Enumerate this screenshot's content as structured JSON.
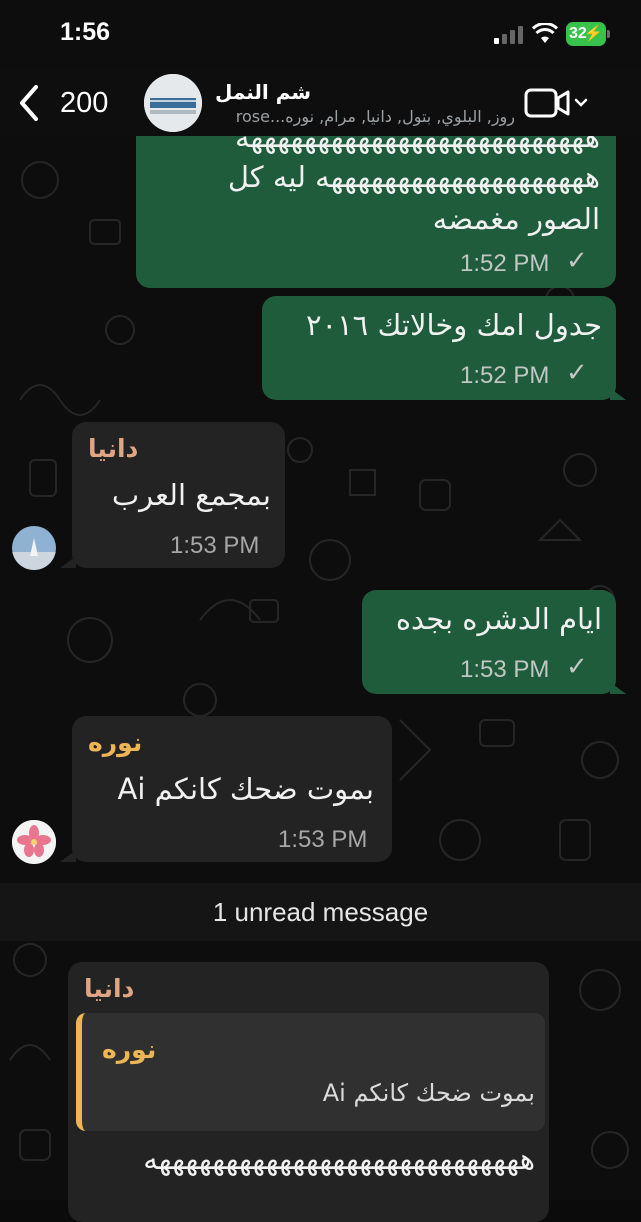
{
  "status_bar": {
    "time": "1:56",
    "battery": "32"
  },
  "header": {
    "back_count": "200",
    "group_name": "شم النمل",
    "members": "روز, البلوي, بتول, دانيا, مرام, نوره...rose"
  },
  "messages": [
    {
      "id": "m1",
      "direction": "out",
      "lines": [
        "ههههههههههههههههههههههههههه",
        "ههههههههههههههههههههه ليه كل",
        "الصور مغمضه"
      ],
      "time": "1:52 PM",
      "status": "sent"
    },
    {
      "id": "m2",
      "direction": "out",
      "lines": [
        "جدول امك وخالاتك ٢٠١٦"
      ],
      "time": "1:52 PM",
      "status": "sent"
    },
    {
      "id": "m3",
      "direction": "in",
      "sender": "دانيا",
      "lines": [
        "بمجمع العرب"
      ],
      "time": "1:53 PM"
    },
    {
      "id": "m4",
      "direction": "out",
      "lines": [
        "ايام الدشره بجده"
      ],
      "time": "1:53 PM",
      "status": "sent"
    },
    {
      "id": "m5",
      "direction": "in",
      "sender": "نوره",
      "lines": [
        "بموت ضحك كانكم Ai"
      ],
      "time": "1:53 PM"
    }
  ],
  "unread_banner": "1 unread message",
  "last_message": {
    "sender": "دانيا",
    "quote_sender": "نوره",
    "quote_text": "بموت ضحك كانكم Ai",
    "text": "ههههههههههههههههههههههههههههه"
  },
  "colors": {
    "outgoing_bubble": "#1e5c3b",
    "incoming_bubble": "#232323",
    "sender_dania": "#e0a583",
    "sender_noura": "#eeb557",
    "battery": "#37c24b"
  },
  "icons": [
    "back-chevron-icon",
    "video-call-icon",
    "chevron-down-icon",
    "signal-icon",
    "wifi-icon",
    "battery-icon",
    "checkmark-icon"
  ]
}
